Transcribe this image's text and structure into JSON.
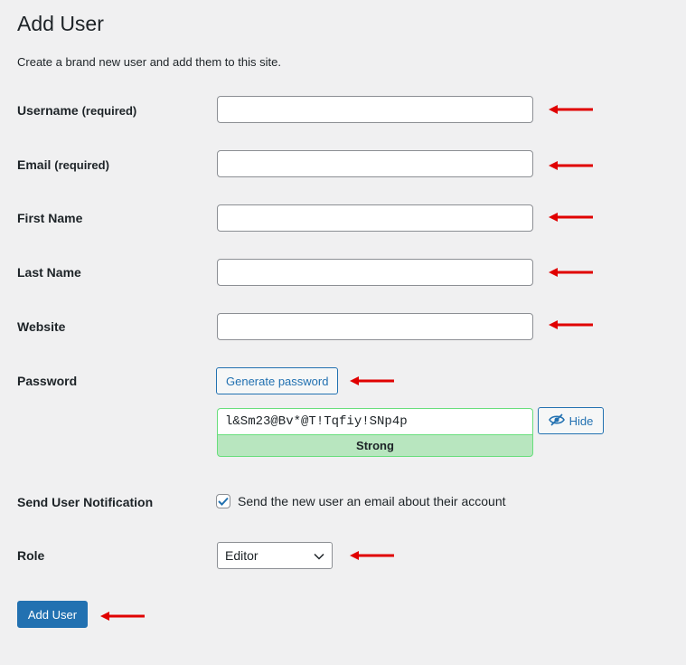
{
  "page": {
    "title": "Add User",
    "description": "Create a brand new user and add them to this site."
  },
  "form": {
    "username": {
      "label": "Username",
      "required": "(required)",
      "value": ""
    },
    "email": {
      "label": "Email",
      "required": "(required)",
      "value": ""
    },
    "first_name": {
      "label": "First Name",
      "value": ""
    },
    "last_name": {
      "label": "Last Name",
      "value": ""
    },
    "website": {
      "label": "Website",
      "value": ""
    },
    "password": {
      "label": "Password",
      "generate_label": "Generate password",
      "value": "l&Sm23@Bv*@T!Tqfiy!SNp4p",
      "strength": "Strong",
      "hide_label": "Hide"
    },
    "notification": {
      "label": "Send User Notification",
      "checkbox_label": "Send the new user an email about their account",
      "checked": true
    },
    "role": {
      "label": "Role",
      "selected": "Editor"
    },
    "submit_label": "Add User"
  },
  "colors": {
    "accent": "#2271b1",
    "arrow": "#e00000",
    "strength_bg": "#b8e6bf",
    "strength_border": "#68de7c"
  },
  "icons": {
    "hide": "eye-slash-icon",
    "checkbox": "checkmark-icon",
    "select": "chevron-down-icon",
    "annotation": "arrow-left-icon"
  }
}
